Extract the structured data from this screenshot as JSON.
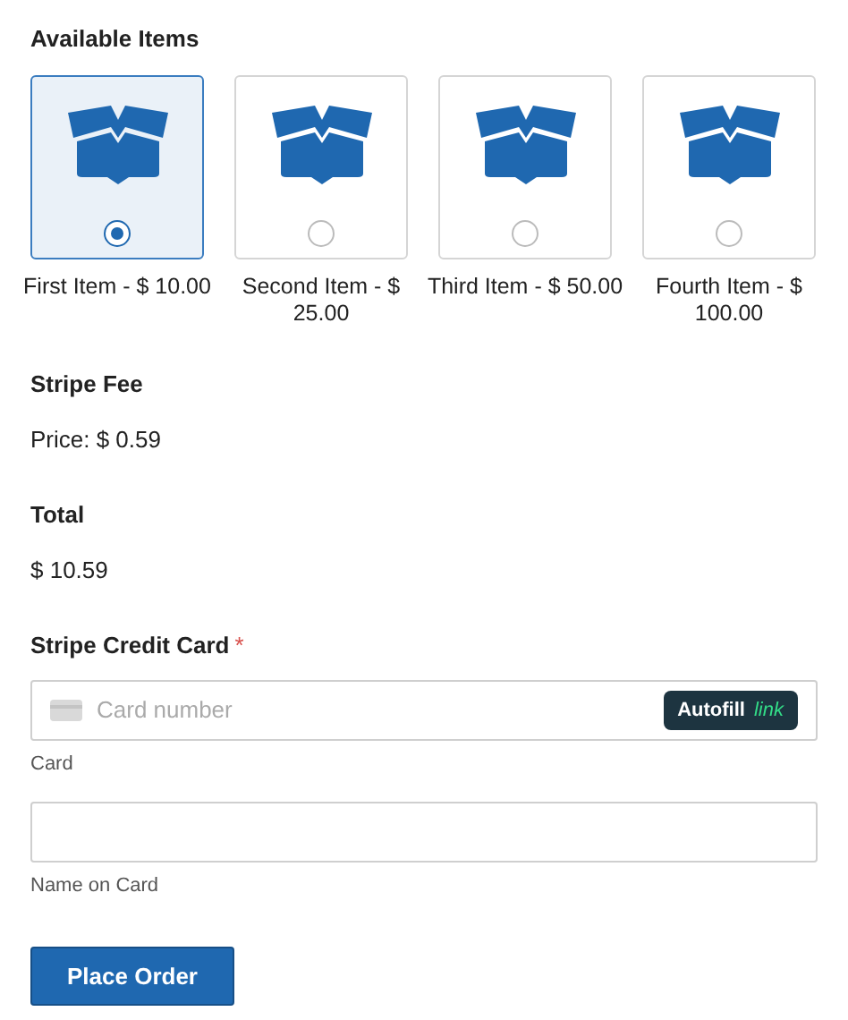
{
  "items_section": {
    "title": "Available Items",
    "items": [
      {
        "label": "First Item - $ 10.00",
        "selected": true
      },
      {
        "label": "Second Item - $ 25.00",
        "selected": false
      },
      {
        "label": "Third Item - $ 50.00",
        "selected": false
      },
      {
        "label": "Fourth Item - $ 100.00",
        "selected": false
      }
    ]
  },
  "fee": {
    "title": "Stripe Fee",
    "price": "Price: $ 0.59"
  },
  "total": {
    "title": "Total",
    "amount": "$ 10.59"
  },
  "card": {
    "title": "Stripe Credit Card",
    "required_mark": "*",
    "card_field": {
      "placeholder": "Card number",
      "autofill": "Autofill",
      "autofill_brand": "link",
      "label": "Card"
    },
    "name_field": {
      "label": "Name on Card"
    }
  },
  "submit": "Place Order"
}
